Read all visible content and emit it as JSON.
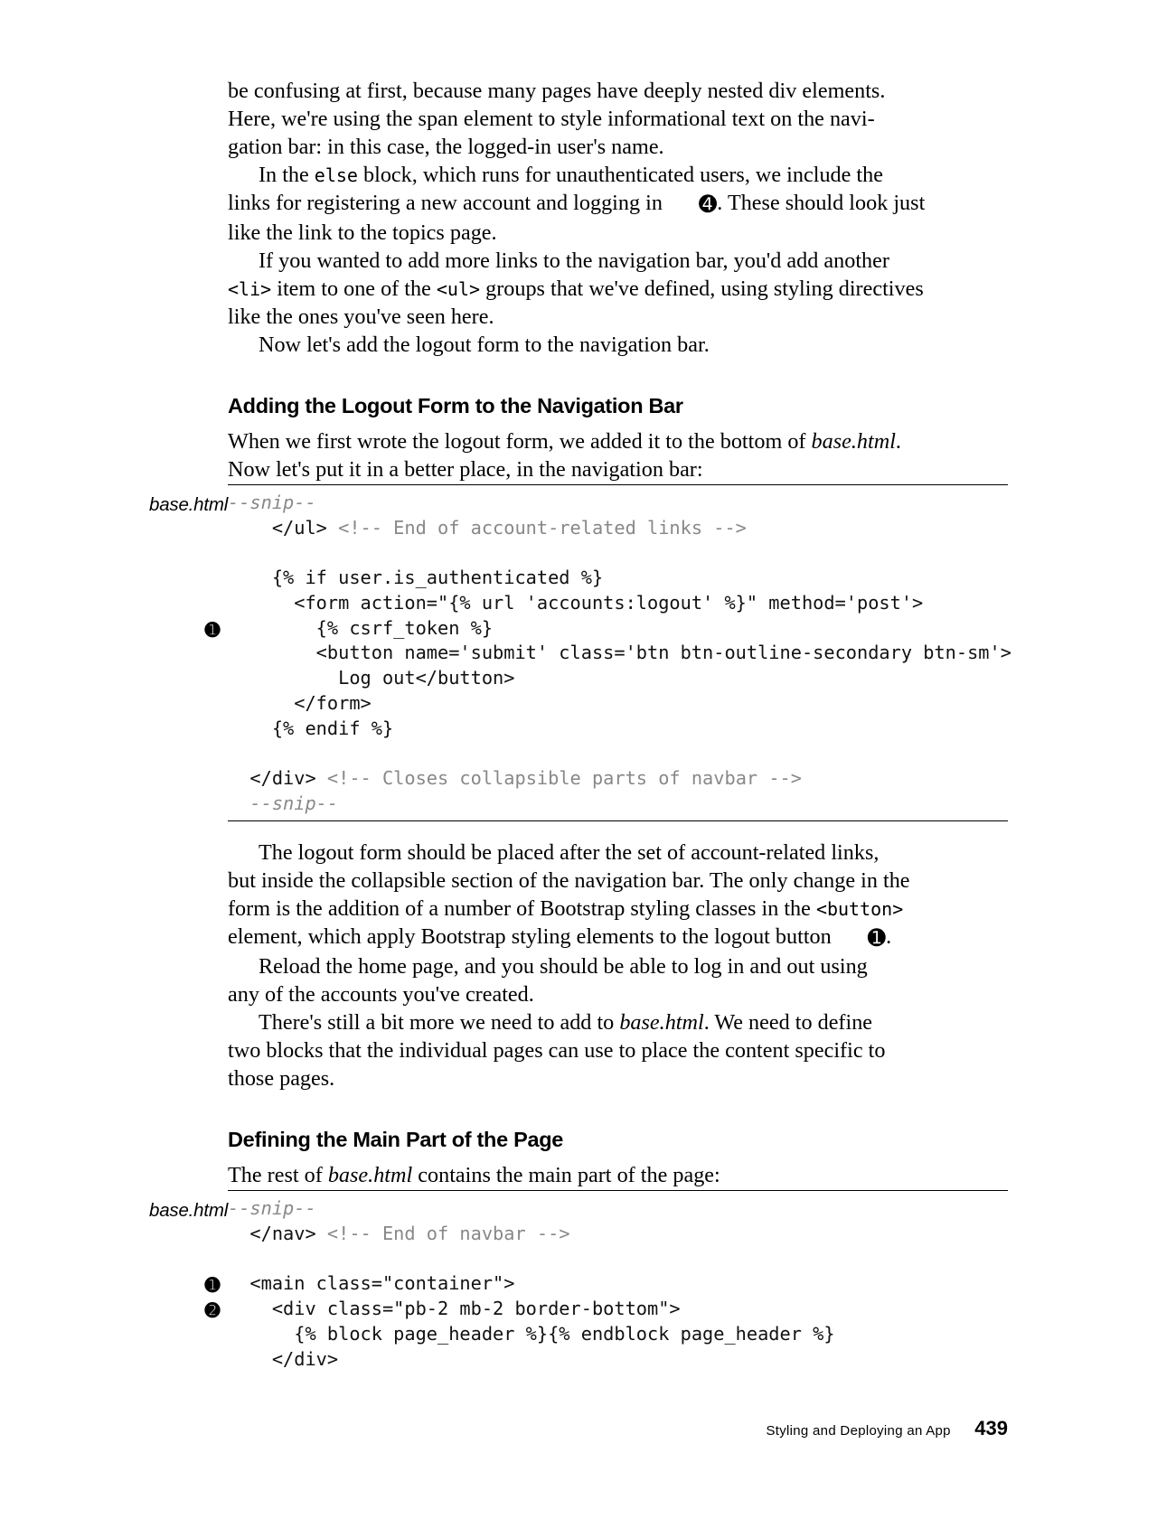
{
  "para1_l1": "be confusing at first, because many pages have deeply nested div elements.",
  "para1_l2": "Here, we're using the span element to style informational text on the navi-",
  "para1_l3": "gation bar: in this case, the logged-in user's name.",
  "para2_pre": "In the ",
  "para2_else": "else",
  "para2_l1b": " block, which runs for unauthenticated users, we include the",
  "para2_l2a": "links for registering a new account and logging in ",
  "para2_mark": "➍",
  "para2_l2b": ". These should look just",
  "para2_l3": "like the link to the topics page.",
  "para3_l1": "If you wanted to add more links to the navigation bar, you'd add another",
  "para3_li": "<li>",
  "para3_mid": " item to one of the ",
  "para3_ul": "<ul>",
  "para3_l2b": " groups that we've defined, using styling directives",
  "para3_l3": "like the ones you've seen here.",
  "para4": "Now let's add the logout form to the navigation bar.",
  "heading1": "Adding the Logout Form to the Navigation Bar",
  "para5_a": "When we first wrote the logout form, we added it to the bottom of ",
  "para5_file": "base.html",
  "para5_b": ".",
  "para5_l2": "Now let's put it in a better place, in the navigation bar:",
  "listing1_label": "base.html",
  "snip": "--snip--",
  "l1_r1a": "    </ul> ",
  "l1_r1b": "<!-- End of account-related links -->",
  "l1_r2": "    {% if user.is_authenticated %}",
  "l1_r3": "      <form action=\"{% url 'accounts:logout' %}\" method='post'>",
  "l1_r4": "        {% csrf_token %}",
  "l1_r5": "        <button name='submit' class='btn btn-outline-secondary btn-sm'>",
  "l1_r6": "          Log out</button>",
  "l1_r7": "      </form>",
  "l1_r8": "    {% endif %}",
  "l1_r9a": "  </div> ",
  "l1_r9b": "<!-- Closes collapsible parts of navbar -->",
  "callout_1": "➊",
  "para6_l1": "The logout form should be placed after the set of account-related links,",
  "para6_l2": "but inside the collapsible section of the navigation bar. The only change in the",
  "para6_l3a": "form is the addition of a number of Bootstrap styling classes in the ",
  "para6_btn": "<button>",
  "para6_l4a": "element, which apply Bootstrap styling elements to the logout button ",
  "para6_mark": "➊",
  "para6_l4b": ".",
  "para7_l1": "Reload the home page, and you should be able to log in and out using",
  "para7_l2": "any of the accounts you've created.",
  "para8_l1a": "There's still a bit more we need to add to ",
  "para8_file": "base.html",
  "para8_l1b": ". We need to define",
  "para8_l2": "two blocks that the individual pages can use to place the content specific to",
  "para8_l3": "those pages.",
  "heading2": "Defining the Main Part of the Page",
  "para9_a": "The rest of ",
  "para9_file": "base.html",
  "para9_b": " contains the main part of the page:",
  "listing2_label": "base.html",
  "l2_r1a": "  </nav> ",
  "l2_r1b": "<!-- End of navbar -->",
  "l2_r2": "  <main class=\"container\">",
  "l2_r3": "    <div class=\"pb-2 mb-2 border-bottom\">",
  "l2_r4": "      {% block page_header %}{% endblock page_header %}",
  "l2_r5": "    </div>",
  "callout_2": "➋",
  "footer_title": "Styling and Deploying an App",
  "footer_page": "439"
}
